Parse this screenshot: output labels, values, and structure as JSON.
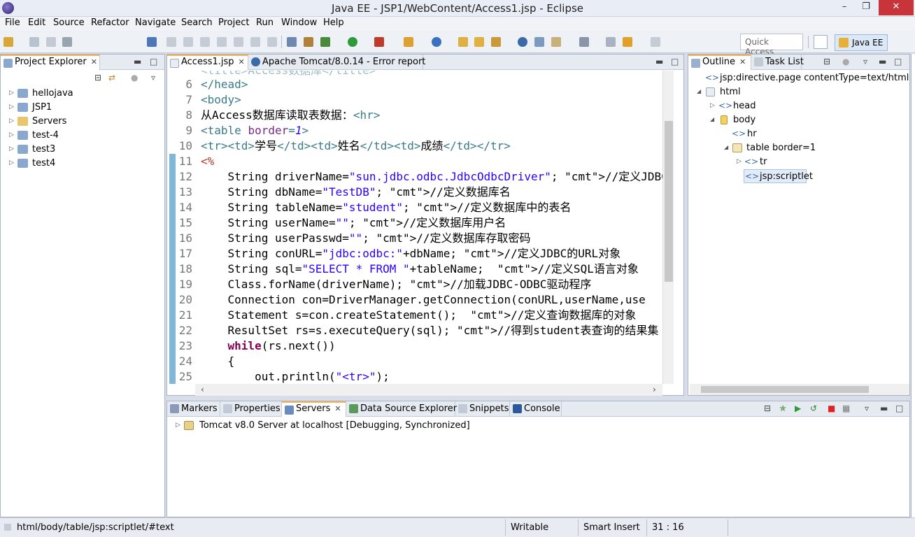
{
  "window": {
    "title": "Java EE - JSP1/WebContent/Access1.jsp - Eclipse"
  },
  "menu": [
    "File",
    "Edit",
    "Source",
    "Refactor",
    "Navigate",
    "Search",
    "Project",
    "Run",
    "Window",
    "Help"
  ],
  "toolbar": {
    "quick_access_placeholder": "Quick Access",
    "perspective": "Java EE"
  },
  "project_explorer": {
    "tab": "Project Explorer",
    "items": [
      {
        "label": "hellojava"
      },
      {
        "label": "JSP1"
      },
      {
        "label": "Servers"
      },
      {
        "label": "test-4"
      },
      {
        "label": "test3"
      },
      {
        "label": "test4"
      }
    ]
  },
  "editor": {
    "tabs": [
      {
        "label": "Access1.jsp"
      },
      {
        "label": "Apache Tomcat/8.0.14 - Error report"
      }
    ],
    "lines": [
      {
        "n": "6",
        "text": "</head>"
      },
      {
        "n": "7",
        "text": "<body>"
      },
      {
        "n": "8",
        "text": "从Access数据库读取表数据：<hr>"
      },
      {
        "n": "9",
        "text": "<table border=1>"
      },
      {
        "n": "10",
        "text": "<tr><td>学号</td><td>姓名</td><td>成绩</td></tr>"
      },
      {
        "n": "11",
        "text": "<%"
      },
      {
        "n": "12",
        "text": "    String driverName=\"sun.jdbc.odbc.JdbcOdbcDriver\"; //定义JDBC-OD"
      },
      {
        "n": "13",
        "text": "    String dbName=\"TestDB\"; //定义数据库名"
      },
      {
        "n": "14",
        "text": "    String tableName=\"student\"; //定义数据库中的表名"
      },
      {
        "n": "15",
        "text": "    String userName=\"\"; //定义数据库用户名"
      },
      {
        "n": "16",
        "text": "    String userPasswd=\"\"; //定义数据库存取密码"
      },
      {
        "n": "17",
        "text": "    String conURL=\"jdbc:odbc:\"+dbName; //定义JDBC的URL对象"
      },
      {
        "n": "18",
        "text": "    String sql=\"SELECT * FROM \"+tableName;  //定义SQL语言对象"
      },
      {
        "n": "19",
        "text": "    Class.forName(driverName); //加载JDBC-ODBC驱动程序"
      },
      {
        "n": "20",
        "text": "    Connection con=DriverManager.getConnection(conURL,userName,use"
      },
      {
        "n": "21",
        "text": "    Statement s=con.createStatement();  //定义查询数据库的对象"
      },
      {
        "n": "22",
        "text": "    ResultSet rs=s.executeQuery(sql); //得到student表查询的结果集"
      },
      {
        "n": "23",
        "text": "    while(rs.next())"
      },
      {
        "n": "24",
        "text": "    {"
      },
      {
        "n": "25",
        "text": "        out.println(\"<tr>\");"
      }
    ]
  },
  "outline": {
    "tabs": [
      {
        "label": "Outline"
      },
      {
        "label": "Task List"
      }
    ],
    "items": [
      {
        "label": "jsp:directive.page contentType=text/html;  cha"
      },
      {
        "label": "html"
      },
      {
        "label": "head"
      },
      {
        "label": "body"
      },
      {
        "label": "hr"
      },
      {
        "label": "table border=1"
      },
      {
        "label": "tr"
      },
      {
        "label": "jsp:scriptlet"
      }
    ]
  },
  "bottom": {
    "tabs": [
      {
        "label": "Markers"
      },
      {
        "label": "Properties"
      },
      {
        "label": "Servers"
      },
      {
        "label": "Data Source Explorer"
      },
      {
        "label": "Snippets"
      },
      {
        "label": "Console"
      }
    ],
    "server": "Tomcat v8.0 Server at localhost  [Debugging, Synchronized]"
  },
  "status": {
    "path": "html/body/table/jsp:scriptlet/#text",
    "writable": "Writable",
    "insert_mode": "Smart Insert",
    "position": "31 : 16"
  },
  "colors": {
    "accent_tab": "#f3b35a",
    "keyword": "#7f0055",
    "string": "#2a00ff",
    "comment": "#3f7f5f",
    "tag": "#3a7b8a"
  }
}
